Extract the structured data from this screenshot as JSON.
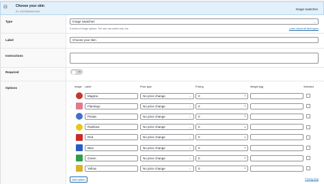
{
  "header": {
    "title": "Choose your skin",
    "id_text": "ID: 6424585ed2de3",
    "type_text": "Image swatches"
  },
  "fields": {
    "type": {
      "label": "Type",
      "value": "Image swatches",
      "hint": "A series of image options. The user can select only one.",
      "link": "Learn about all field types"
    },
    "label": {
      "label": "Label",
      "value": "Choose your skin"
    },
    "instructions": {
      "label": "Instructions",
      "value": ""
    },
    "required": {
      "label": "Required",
      "toggle_text": "No"
    },
    "options": {
      "label": "Options"
    }
  },
  "options_table": {
    "headers": {
      "image": "Image",
      "label": "Label",
      "price_type": "Price type",
      "pricing": "Pricing",
      "weight": "Weight (kg)",
      "selected": "Selected"
    },
    "rows": [
      {
        "label": "Magma",
        "price_type": "No price change",
        "pricing": "0",
        "color": "#c0392b",
        "round": true
      },
      {
        "label": "Flamingo",
        "price_type": "No price change",
        "pricing": "0",
        "color": "#e07a8e",
        "round": false
      },
      {
        "label": "Pinata",
        "price_type": "No price change",
        "pricing": "0",
        "color": "#3f6fd1",
        "round": true
      },
      {
        "label": "Rainbow",
        "price_type": "No price change",
        "pricing": "0",
        "color": "#e8c61e",
        "round": true
      },
      {
        "label": "Red",
        "price_type": "No price change",
        "pricing": "0",
        "color": "#cc2a2a",
        "round": false
      },
      {
        "label": "Blue",
        "price_type": "No price change",
        "pricing": "0",
        "color": "#2a5cc4",
        "round": false
      },
      {
        "label": "Green",
        "price_type": "No price change",
        "pricing": "0",
        "color": "#2e9e4e",
        "round": false
      },
      {
        "label": "Yellow",
        "price_type": "No price change",
        "pricing": "0",
        "color": "#d6b32a",
        "round": false
      }
    ]
  },
  "actions": {
    "add_option": "Add option",
    "pricing_help": "Pricing help"
  }
}
